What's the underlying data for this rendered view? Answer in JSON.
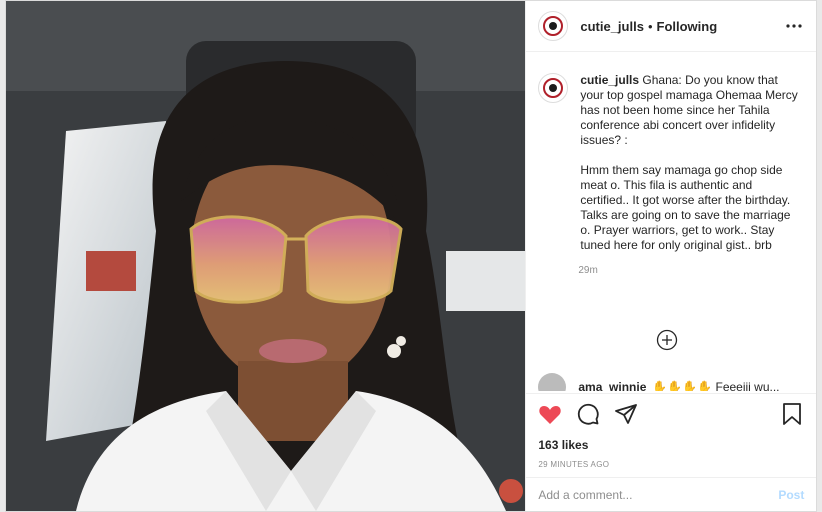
{
  "header": {
    "username": "cutie_julls",
    "separator": "•",
    "follow_status": "Following"
  },
  "caption": {
    "username": "cutie_julls",
    "text1": "Ghana: Do you know that your top gospel mamaga Ohemaa Mercy has not been home since her Tahila conference abi concert over infidelity issues? :",
    "text2": "Hmm them say mamaga go chop side meat o. This fila is authentic and certified.. It got worse after the birthday. Talks are going on to save the marriage o. Prayer warriors, get to work.. Stay tuned here for only original gist.. brb",
    "time": "29m"
  },
  "next_comment": {
    "username": "ama_winnie",
    "text": "✋✋✋✋ Feeeiii wu..."
  },
  "actions": {
    "likes": "163 likes",
    "time_ago": "29 MINUTES AGO"
  },
  "add_comment": {
    "placeholder": "Add a comment...",
    "post_label": "Post"
  },
  "icons": {
    "like": "heart-filled-icon",
    "comment": "comment-icon",
    "share": "share-icon",
    "save": "bookmark-icon",
    "more": "more-options-icon",
    "load": "plus-circle-icon"
  },
  "colors": {
    "like": "#ed4956",
    "post": "#b3dbff",
    "muted": "#8e8e8e"
  }
}
